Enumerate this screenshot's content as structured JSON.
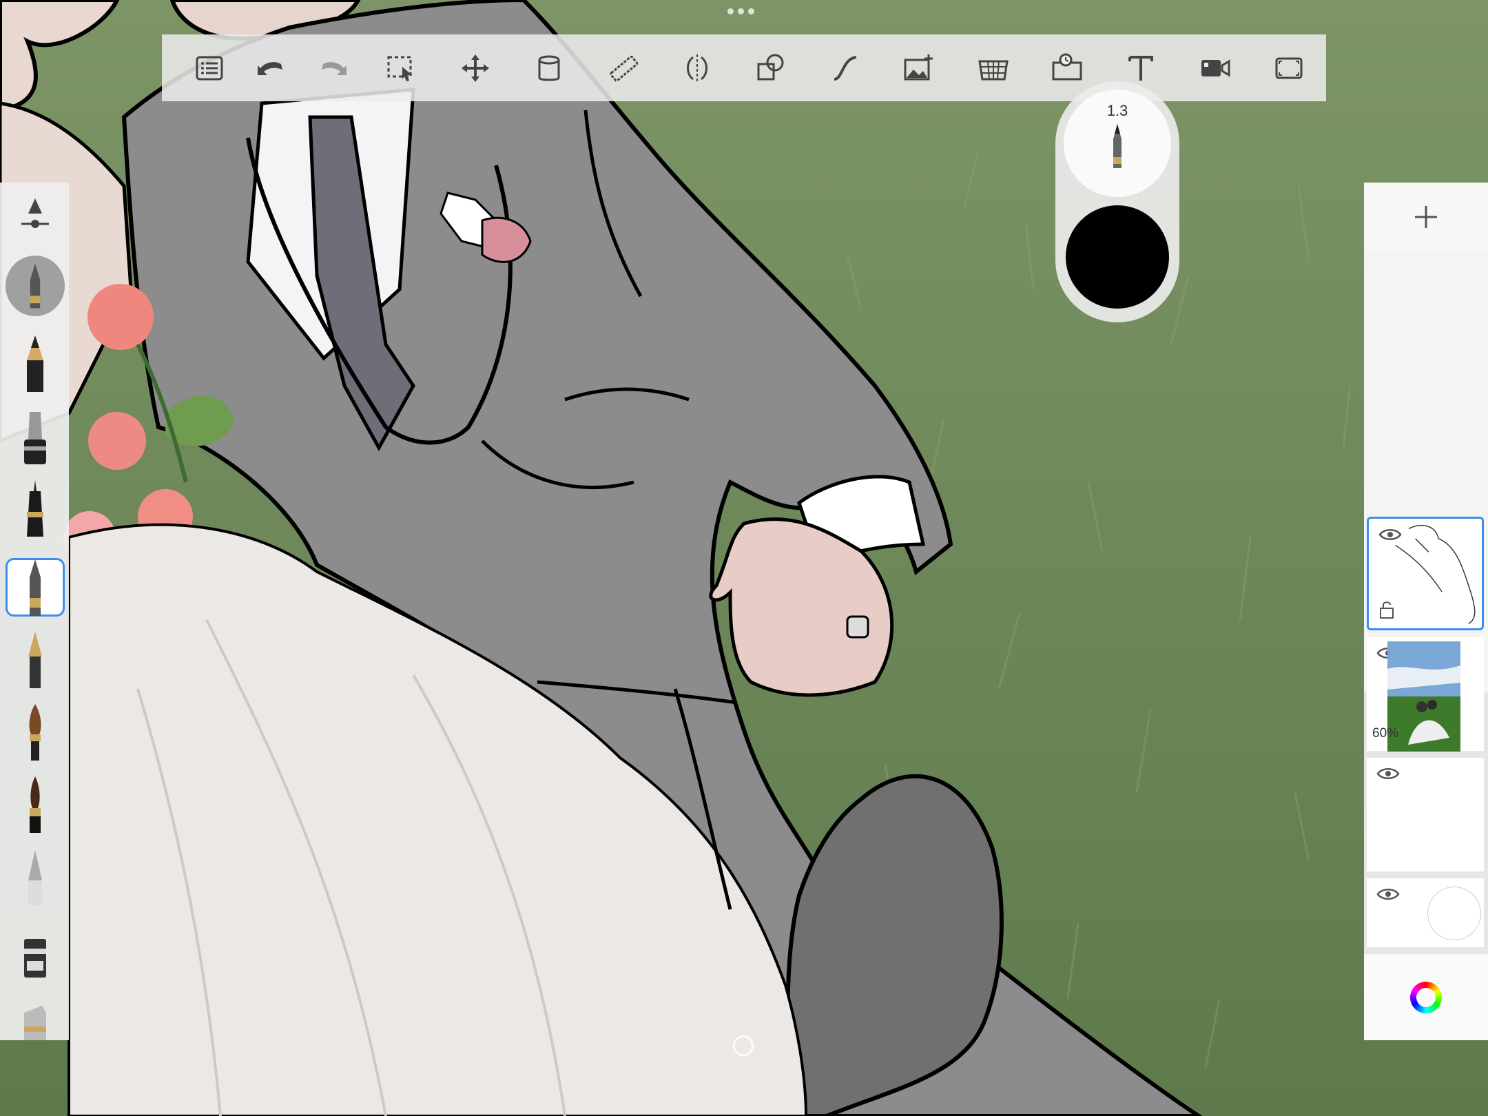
{
  "toolbar": {
    "items": [
      {
        "name": "layers-list"
      },
      {
        "name": "undo"
      },
      {
        "name": "redo"
      },
      {
        "name": "selection"
      },
      {
        "name": "transform"
      },
      {
        "name": "fill"
      },
      {
        "name": "ruler"
      },
      {
        "name": "symmetry"
      },
      {
        "name": "shapes"
      },
      {
        "name": "curve"
      },
      {
        "name": "add-image"
      },
      {
        "name": "perspective"
      },
      {
        "name": "time-lapse"
      },
      {
        "name": "text"
      },
      {
        "name": "video"
      },
      {
        "name": "fullscreen"
      }
    ]
  },
  "brush_puck": {
    "size_label": "1.3",
    "color": "#000000"
  },
  "brush_palette": {
    "selected_index": 5,
    "brushes": [
      "brush-settings",
      "current-brush",
      "pencil",
      "marker",
      "technical-pen",
      "ballpoint-pen",
      "fountain-pen",
      "paint-brush",
      "ink-brush",
      "airbrush",
      "chisel-marker",
      "highlighter"
    ]
  },
  "layers": {
    "items": [
      {
        "name": "line-art-layer",
        "opacity_label": "",
        "selected": true,
        "locked": true
      },
      {
        "name": "photo-layer",
        "opacity_label": "60%",
        "selected": false,
        "locked": false
      },
      {
        "name": "empty-layer",
        "opacity_label": "",
        "selected": false,
        "locked": false
      },
      {
        "name": "background-layer",
        "opacity_label": "",
        "selected": false,
        "locked": false
      }
    ]
  },
  "colors": {
    "accent": "#3d8ef0",
    "grass": "#6f8a5a",
    "suit": "#8a8a8a",
    "dress": "#e6e3e1"
  }
}
